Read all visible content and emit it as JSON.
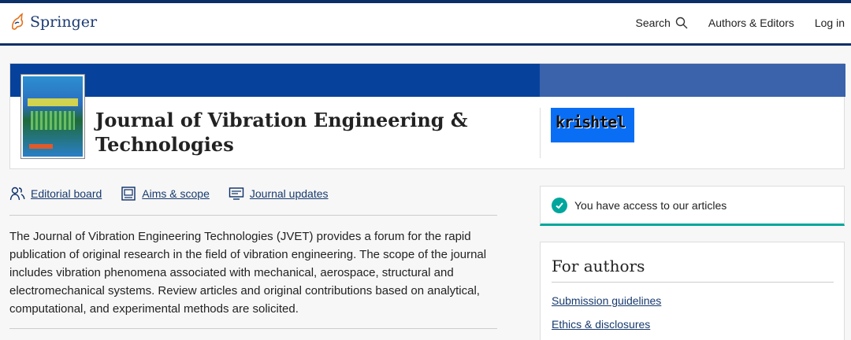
{
  "header": {
    "brand": "Springer",
    "nav": {
      "search": "Search",
      "authors_editors": "Authors & Editors",
      "login": "Log in"
    }
  },
  "journal": {
    "title": "Journal of Vibration Engineering & Technologies",
    "partner_logo_text": "krishtel"
  },
  "links": {
    "editorial_board": "Editorial board",
    "aims_scope": "Aims & scope",
    "journal_updates": "Journal updates"
  },
  "description": "The Journal of Vibration Engineering Technologies (JVET) provides a forum for the rapid publication of original research in the field of vibration engineering.  The scope of the journal includes vibration phenomena associated with mechanical, aerospace, structural and electromechanical systems. Review articles and original contributions based on analytical, computational, and experimental methods are solicited.",
  "access": {
    "text": "You have access to our articles"
  },
  "for_authors": {
    "heading": "For authors",
    "items": [
      "Submission guidelines",
      "Ethics & disclosures"
    ]
  },
  "colors": {
    "brand_navy": "#0a2f66",
    "band_blue": "#06429b",
    "access_teal": "#00a69c",
    "link": "#173a6e"
  }
}
